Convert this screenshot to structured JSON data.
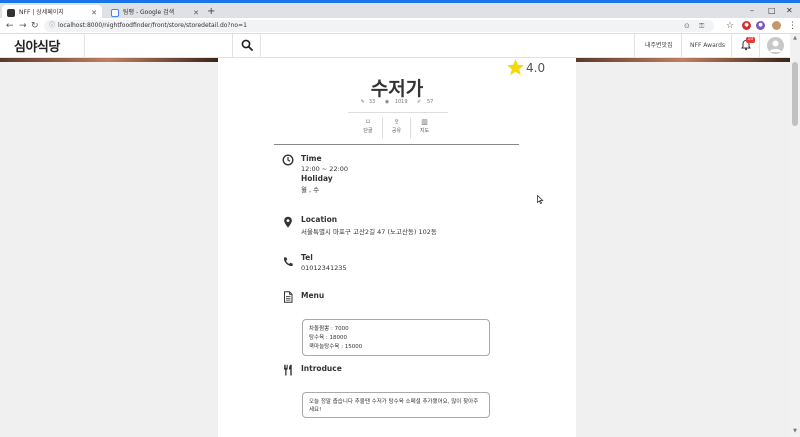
{
  "browser": {
    "tabs": [
      {
        "title": "NFF | 상세페이지",
        "active": true
      },
      {
        "title": "팀팽 - Google 검색",
        "active": false
      }
    ],
    "url": "localhost:8000/nightfoodfinder/front/store/storedetail.do?no=1"
  },
  "header": {
    "logo_text": "심야식당",
    "nav": [
      {
        "label": "내주변맛집"
      },
      {
        "label": "NFF Awards"
      }
    ],
    "notification_count": "10"
  },
  "store": {
    "name": "수저가",
    "rating": "4.0",
    "stats": {
      "reviews": "33",
      "views": "1019",
      "likes": "57"
    },
    "actions": [
      "단골",
      "공유",
      "지도"
    ],
    "time": {
      "title": "Time",
      "hours": "12:00 ~ 22:00",
      "holiday_title": "Holiday",
      "holiday": "월 , 수"
    },
    "location": {
      "title": "Location",
      "address": "서울특별시 마포구 고산2길 47 (노고산동) 102동"
    },
    "tel": {
      "title": "Tel",
      "number": "01012341235"
    },
    "menu": {
      "title": "Menu",
      "items": [
        "차돌짬뽕 : 7000",
        "탕수육 : 18000",
        "쿡마늘탕수육 : 15000"
      ]
    },
    "introduce": {
      "title": "Introduce",
      "text": "오늘 정말 춥습니다 추울땐 수저가 탕수육 소페셜 추가됐어요, 많이 찾아주세요!"
    }
  },
  "colors": {
    "accent": "#1a73e8",
    "star": "#f5d90a",
    "badge": "#e53935"
  }
}
